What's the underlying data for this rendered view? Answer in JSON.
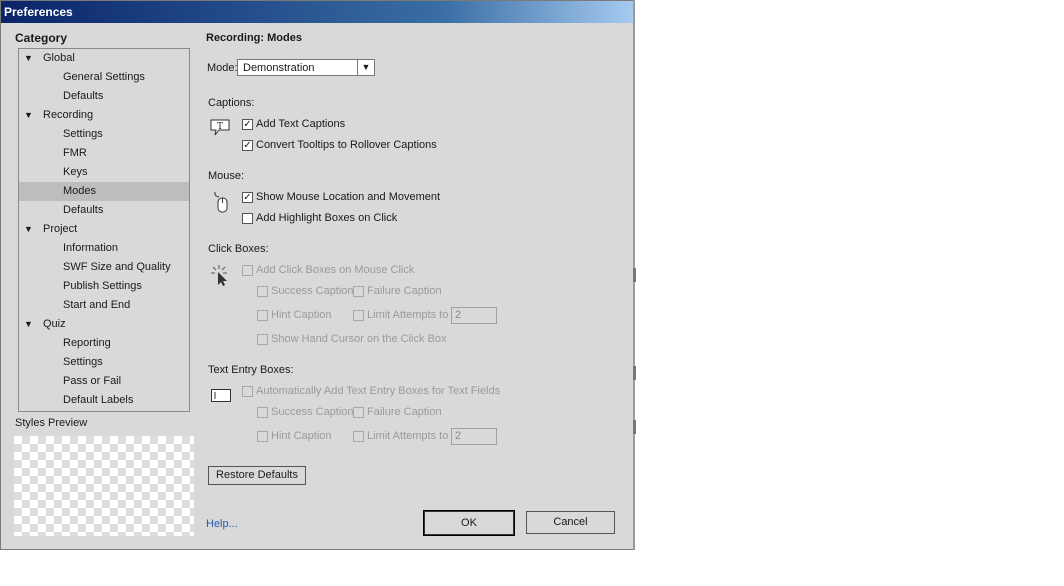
{
  "window": {
    "title": "Preferences"
  },
  "sidebar": {
    "title": "Category",
    "items": [
      {
        "label": "Global",
        "group": true
      },
      {
        "label": "General Settings",
        "group": false
      },
      {
        "label": "Defaults",
        "group": false
      },
      {
        "label": "Recording",
        "group": true
      },
      {
        "label": "Settings",
        "group": false
      },
      {
        "label": "FMR",
        "group": false
      },
      {
        "label": "Keys",
        "group": false
      },
      {
        "label": "Modes",
        "group": false,
        "selected": true
      },
      {
        "label": "Defaults",
        "group": false
      },
      {
        "label": "Project",
        "group": true
      },
      {
        "label": "Information",
        "group": false
      },
      {
        "label": "SWF Size and Quality",
        "group": false
      },
      {
        "label": "Publish Settings",
        "group": false
      },
      {
        "label": "Start and End",
        "group": false
      },
      {
        "label": "Quiz",
        "group": true
      },
      {
        "label": "Reporting",
        "group": false
      },
      {
        "label": "Settings",
        "group": false
      },
      {
        "label": "Pass or Fail",
        "group": false
      },
      {
        "label": "Default Labels",
        "group": false
      }
    ],
    "expand_glyph": "▼",
    "styles_preview_label": "Styles Preview"
  },
  "main": {
    "heading": "Recording: Modes",
    "mode": {
      "label": "Mode:",
      "value": "Demonstration",
      "arrow": "▼"
    },
    "captions": {
      "label": "Captions:",
      "icon": "T",
      "add_text_captions": "Add Text Captions",
      "convert_tooltips": "Convert Tooltips to Rollover Captions"
    },
    "mouse": {
      "label": "Mouse:",
      "show_mouse": "Show Mouse Location and Movement",
      "add_highlight": "Add Highlight Boxes on Click"
    },
    "click_boxes": {
      "label": "Click Boxes:",
      "add_click_boxes": "Add Click Boxes on Mouse Click",
      "success": "Success Caption",
      "failure": "Failure Caption",
      "hint": "Hint Caption",
      "limit": "Limit Attempts to",
      "limit_value": "2",
      "hand_cursor": "Show Hand Cursor on the Click Box"
    },
    "text_entry": {
      "label": "Text Entry Boxes:",
      "auto_add": "Automatically Add Text Entry Boxes for Text Fields",
      "success": "Success Caption",
      "failure": "Failure Caption",
      "hint": "Hint Caption",
      "limit": "Limit Attempts to",
      "limit_value": "2"
    },
    "checkmark": "✓",
    "restore_defaults": "Restore Defaults"
  },
  "footer": {
    "help": "Help...",
    "ok": "OK",
    "cancel": "Cancel"
  }
}
